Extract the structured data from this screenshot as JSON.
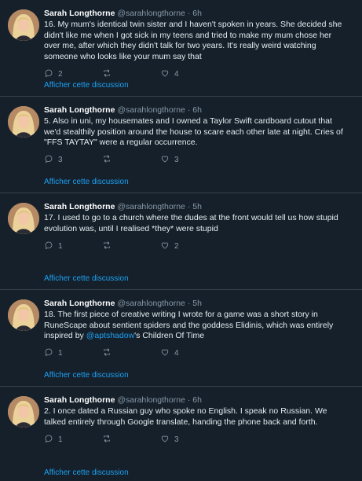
{
  "author": {
    "name": "Sarah Longthorne",
    "handle": "@sarahlongthorne",
    "separator": "·"
  },
  "thread_link_label": "Afficher cette discussion",
  "icons": {
    "reply": "reply-icon",
    "retweet": "retweet-icon",
    "like": "like-icon"
  },
  "colors": {
    "background": "#15202b",
    "accent": "#1da1f2",
    "muted": "#8899a6",
    "divider": "#38444d"
  },
  "tweets": [
    {
      "time": "6h",
      "text": "16. My mum's identical twin sister and I haven't spoken in years. She decided she didn't like me when I got sick in my teens and tried to make my mum chose her over me, after which they didn't talk for two years. It's really weird watching someone who looks like your mum say that",
      "replies": "2",
      "retweets": "",
      "likes": "4"
    },
    {
      "time": "6h",
      "text": "5. Also in uni, my housemates and I owned a Taylor Swift cardboard cutout that we'd stealthily position around the house to scare each other late at night. Cries of \"FFS TAYTAY\" were a regular occurrence.",
      "replies": "3",
      "retweets": "",
      "likes": "3"
    },
    {
      "time": "5h",
      "text": "17. I used to go to a church where the dudes at the front would tell us how stupid evolution was, until I realised *they* were stupid",
      "replies": "1",
      "retweets": "",
      "likes": "2"
    },
    {
      "time": "5h",
      "text_before": "18. The first piece of creative writing I wrote for a game was a short story in RuneScape about sentient spiders and the goddess Elidinis, which was entirely inspired by ",
      "mention": "@aptshadow",
      "text_after": "'s Children Of Time",
      "replies": "1",
      "retweets": "",
      "likes": "4"
    },
    {
      "time": "6h",
      "text": "2. I once dated a Russian guy who spoke no English. I speak no Russian. We talked entirely through Google translate, handing the phone back and forth.",
      "replies": "1",
      "retweets": "",
      "likes": "3"
    }
  ]
}
